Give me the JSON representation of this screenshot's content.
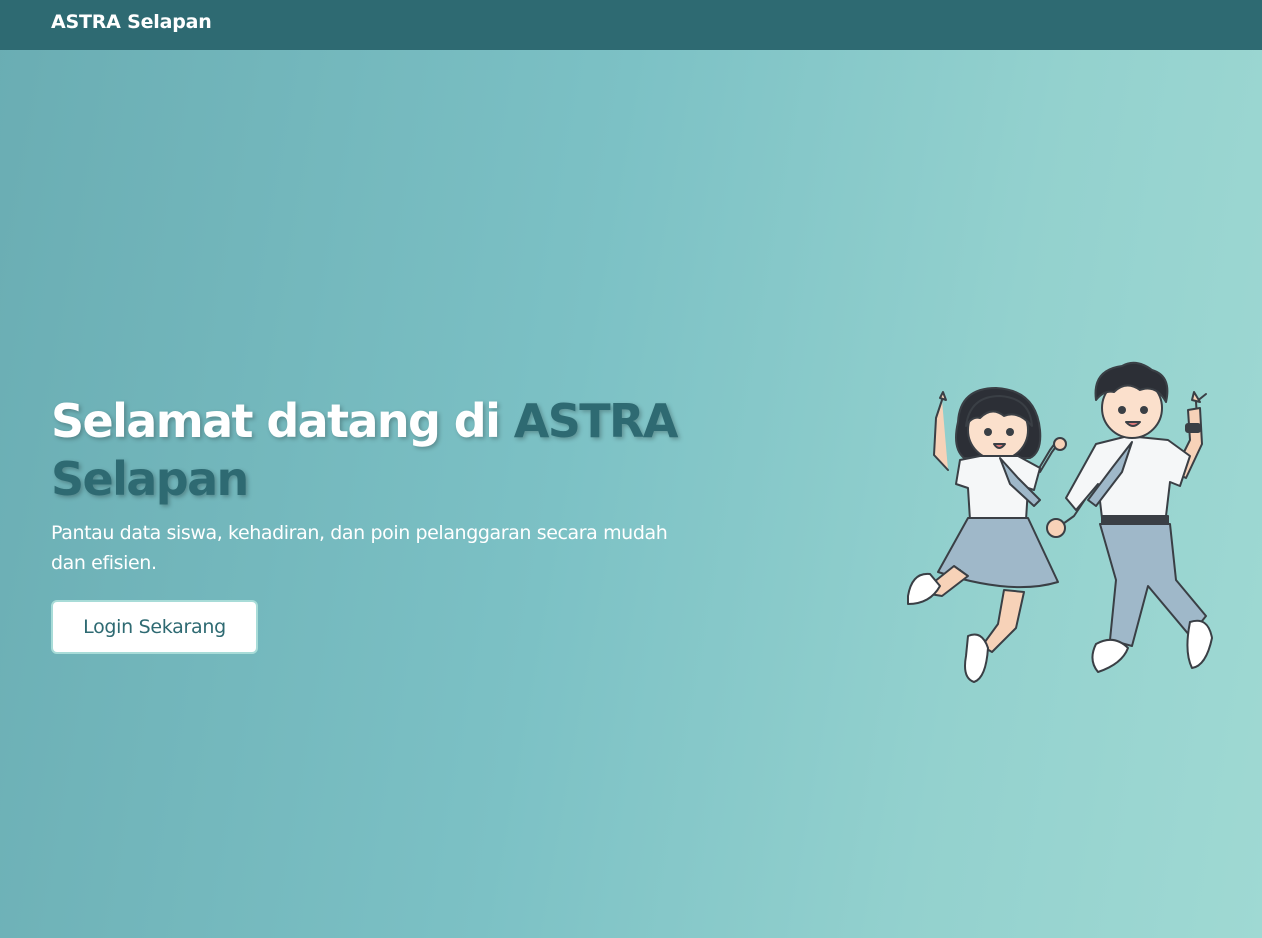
{
  "navbar": {
    "brand": "ASTRA Selapan"
  },
  "hero": {
    "headline_prefix": "Selamat datang di ",
    "headline_accent": "ASTRA Selapan",
    "subtitle": "Pantau data siswa, kehadiran, dan poin pelanggaran secara mudah dan efisien.",
    "cta_label": "Login Sekarang",
    "illustration": "jumping-students-illustration"
  },
  "colors": {
    "navbar": "#2e6a72",
    "accent": "#2e6a72",
    "background_start": "#6aadb3",
    "background_end": "#9fd9d3",
    "button_bg": "#ffffff",
    "button_text": "#2e6a72"
  }
}
